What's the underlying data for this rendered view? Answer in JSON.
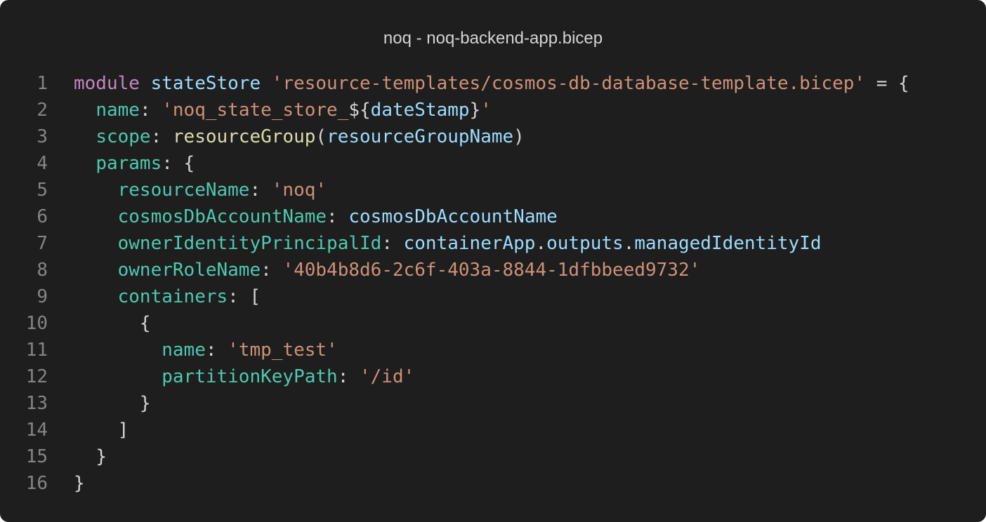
{
  "window": {
    "title": "noq - noq-backend-app.bicep"
  },
  "colors": {
    "background": "#1e1e1e",
    "keyword": "#c586c0",
    "variable": "#9cdcfe",
    "string": "#ce9178",
    "property": "#4ec9b0",
    "function": "#dcdcaa",
    "punctuation": "#d4d4d4",
    "line_number": "#858585"
  },
  "code": {
    "lines": [
      {
        "num": "1",
        "tokens": [
          [
            "kw",
            "module"
          ],
          [
            "punc",
            " "
          ],
          [
            "var",
            "stateStore"
          ],
          [
            "punc",
            " "
          ],
          [
            "str",
            "'resource-templates/cosmos-db-database-template.bicep'"
          ],
          [
            "punc",
            " = {"
          ]
        ]
      },
      {
        "num": "2",
        "tokens": [
          [
            "ind",
            "  "
          ],
          [
            "prop",
            "name"
          ],
          [
            "punc",
            ": "
          ],
          [
            "str",
            "'noq_state_store_"
          ],
          [
            "punc",
            "${"
          ],
          [
            "var",
            "dateStamp"
          ],
          [
            "punc",
            "}"
          ],
          [
            "str",
            "'"
          ]
        ]
      },
      {
        "num": "3",
        "tokens": [
          [
            "ind",
            "  "
          ],
          [
            "prop",
            "scope"
          ],
          [
            "punc",
            ": "
          ],
          [
            "fn",
            "resourceGroup"
          ],
          [
            "punc",
            "("
          ],
          [
            "var",
            "resourceGroupName"
          ],
          [
            "punc",
            ")"
          ]
        ]
      },
      {
        "num": "4",
        "tokens": [
          [
            "ind",
            "  "
          ],
          [
            "prop",
            "params"
          ],
          [
            "punc",
            ": {"
          ]
        ]
      },
      {
        "num": "5",
        "tokens": [
          [
            "ind",
            "    "
          ],
          [
            "prop",
            "resourceName"
          ],
          [
            "punc",
            ": "
          ],
          [
            "str",
            "'noq'"
          ]
        ]
      },
      {
        "num": "6",
        "tokens": [
          [
            "ind",
            "    "
          ],
          [
            "prop",
            "cosmosDbAccountName"
          ],
          [
            "punc",
            ": "
          ],
          [
            "var",
            "cosmosDbAccountName"
          ]
        ]
      },
      {
        "num": "7",
        "tokens": [
          [
            "ind",
            "    "
          ],
          [
            "prop",
            "ownerIdentityPrincipalId"
          ],
          [
            "punc",
            ": "
          ],
          [
            "var",
            "containerApp"
          ],
          [
            "punc",
            "."
          ],
          [
            "var",
            "outputs"
          ],
          [
            "punc",
            "."
          ],
          [
            "var",
            "managedIdentityId"
          ]
        ]
      },
      {
        "num": "8",
        "tokens": [
          [
            "ind",
            "    "
          ],
          [
            "prop",
            "ownerRoleName"
          ],
          [
            "punc",
            ": "
          ],
          [
            "str",
            "'40b4b8d6-2c6f-403a-8844-1dfbbeed9732'"
          ]
        ]
      },
      {
        "num": "9",
        "tokens": [
          [
            "ind",
            "    "
          ],
          [
            "prop",
            "containers"
          ],
          [
            "punc",
            ": ["
          ]
        ]
      },
      {
        "num": "10",
        "tokens": [
          [
            "ind",
            "      "
          ],
          [
            "punc",
            "{"
          ]
        ]
      },
      {
        "num": "11",
        "tokens": [
          [
            "ind",
            "        "
          ],
          [
            "prop",
            "name"
          ],
          [
            "punc",
            ": "
          ],
          [
            "str",
            "'tmp_test'"
          ]
        ]
      },
      {
        "num": "12",
        "tokens": [
          [
            "ind",
            "        "
          ],
          [
            "prop",
            "partitionKeyPath"
          ],
          [
            "punc",
            ": "
          ],
          [
            "str",
            "'/id'"
          ]
        ]
      },
      {
        "num": "13",
        "tokens": [
          [
            "ind",
            "      "
          ],
          [
            "punc",
            "}"
          ]
        ]
      },
      {
        "num": "14",
        "tokens": [
          [
            "ind",
            "    "
          ],
          [
            "punc",
            "]"
          ]
        ]
      },
      {
        "num": "15",
        "tokens": [
          [
            "ind",
            "  "
          ],
          [
            "punc",
            "}"
          ]
        ]
      },
      {
        "num": "16",
        "tokens": [
          [
            "punc",
            "}"
          ]
        ]
      }
    ]
  }
}
